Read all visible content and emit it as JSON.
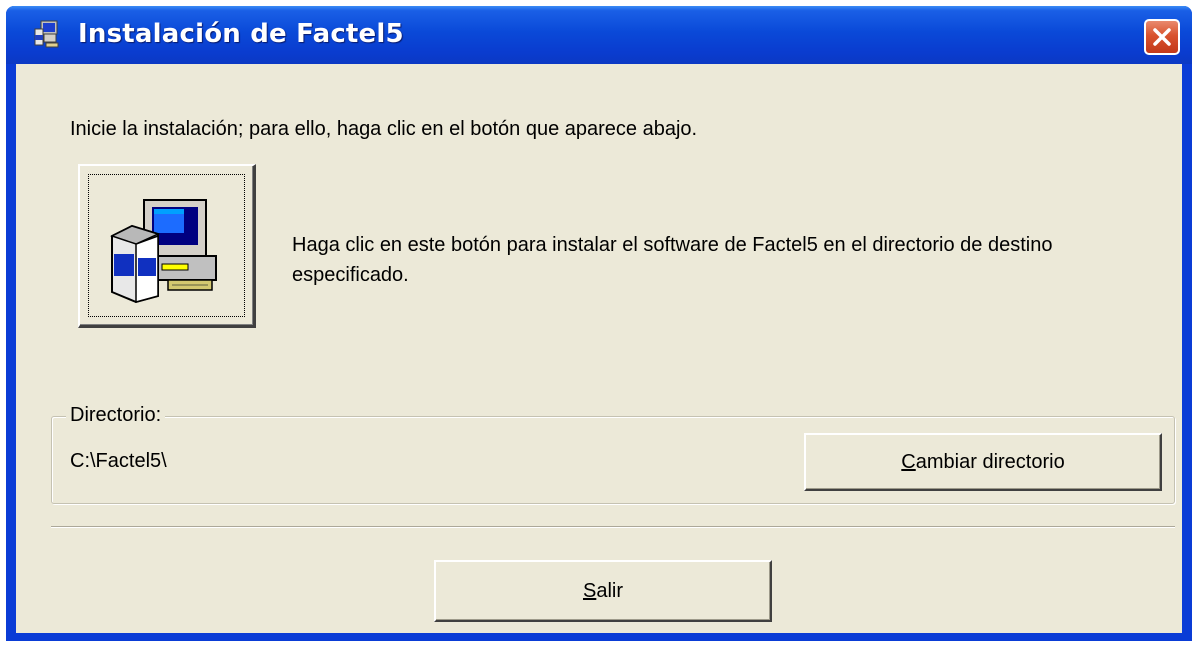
{
  "window": {
    "title": "Instalación de Factel5",
    "title_icon": "setup-computer-icon",
    "close_icon": "close-x-icon"
  },
  "main": {
    "instruction": "Inicie la instalación; para ello, haga clic en el botón que aparece abajo.",
    "setup_button_icon": "setup-computer-icon",
    "description": "Haga clic en este botón para instalar el software de Factel5 en el directorio de destino especificado."
  },
  "directory": {
    "group_label": "Directorio:",
    "path": "C:\\Factel5\\",
    "change_button_mnemonic": "C",
    "change_button_rest": "ambiar directorio"
  },
  "footer": {
    "exit_button_mnemonic": "S",
    "exit_button_rest": "alir"
  },
  "colors": {
    "titlebar": "#0a49d8",
    "client_bg": "#ece9d8",
    "close_button": "#d9532e"
  }
}
